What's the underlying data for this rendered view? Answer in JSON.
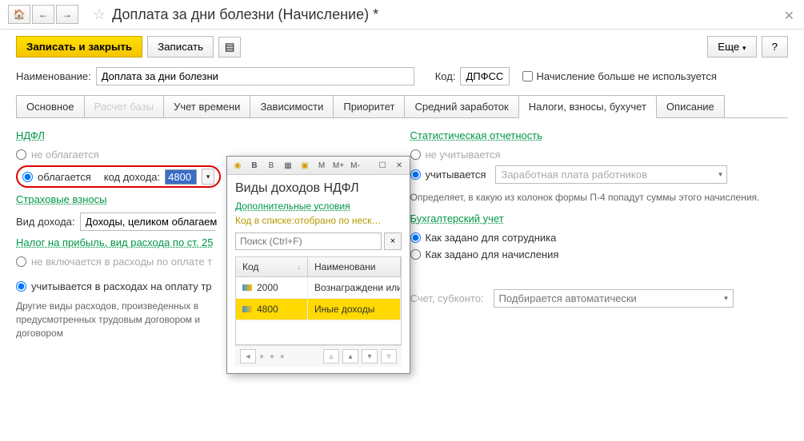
{
  "header": {
    "title": "Доплата за дни болезни (Начисление) *"
  },
  "toolbar": {
    "save_close": "Записать и закрыть",
    "save": "Записать",
    "more": "Еще",
    "help": "?"
  },
  "form": {
    "name_label": "Наименование:",
    "name_value": "Доплата за дни болезни",
    "code_label": "Код:",
    "code_value": "ДПФСС",
    "not_used_label": "Начисление больше не используется"
  },
  "tabs": [
    "Основное",
    "Расчет базы",
    "Учет времени",
    "Зависимости",
    "Приоритет",
    "Средний заработок",
    "Налоги, взносы, бухучет",
    "Описание"
  ],
  "ndfl": {
    "header": "НДФЛ",
    "not_taxed": "не облагается",
    "taxed": "облагается",
    "code_label": "код дохода:",
    "code_value": "4800"
  },
  "insurance": {
    "header": "Страховые взносы",
    "type_label": "Вид дохода:",
    "type_value": "Доходы, целиком облагаем"
  },
  "profit_tax": {
    "header": "Налог на прибыль, вид расхода по ст. 25",
    "not_included": "не включается в расходы по оплате т",
    "included": "учитывается в расходах на оплату тр"
  },
  "other_expenses": "Другие виды расходов, произведенных в\nпредусмотренных трудовым договором и\nдоговором",
  "stats": {
    "header": "Статистическая отчетность",
    "not_counted": "не учитывается",
    "counted": "учитывается",
    "value": "Заработная плата работников",
    "desc": "Определяет, в какую из колонок формы П-4 попадут суммы этого начисления."
  },
  "accounting": {
    "header": "Бухгалтерский учет",
    "by_employee": "Как задано для сотрудника",
    "by_accrual": "Как задано для начисления",
    "account_label": "Счет, субконто:",
    "account_placeholder": "Подбирается автоматически"
  },
  "popup": {
    "title": "Виды доходов НДФЛ",
    "sub1": "Дополнительные условия",
    "sub2": "Код в списке:отобрано по неск…",
    "search_placeholder": "Поиск (Ctrl+F)",
    "th_code": "Код",
    "th_name": "Наименовани",
    "rows": [
      {
        "code": "2000",
        "name": "Вознаграждени или иных обяз"
      },
      {
        "code": "4800",
        "name": "Иные доходы"
      }
    ],
    "toolbar_btns": [
      "В",
      "В",
      "M",
      "M+",
      "M-"
    ]
  }
}
